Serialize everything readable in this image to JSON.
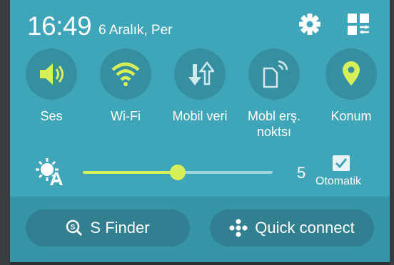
{
  "status": {
    "time": "16:49",
    "date": "6 Aralık, Per"
  },
  "toggles": [
    {
      "label": "Ses",
      "icon": "speaker-icon"
    },
    {
      "label": "Wi-Fi",
      "icon": "wifi-icon"
    },
    {
      "label": "Mobil veri",
      "icon": "mobile-data-icon"
    },
    {
      "label": "Mobl erş. noktsı",
      "icon": "hotspot-icon"
    },
    {
      "label": "Konum",
      "icon": "location-pin-icon"
    }
  ],
  "brightness": {
    "value": "5",
    "level_fraction": 0.5,
    "auto_label": "Otomatik",
    "auto_checked": true
  },
  "actions": {
    "s_finder": "S Finder",
    "quick_connect": "Quick connect"
  },
  "colors": {
    "panel": "#3fa5b8",
    "active": "#d7f05a",
    "circle": "#368fa0"
  }
}
